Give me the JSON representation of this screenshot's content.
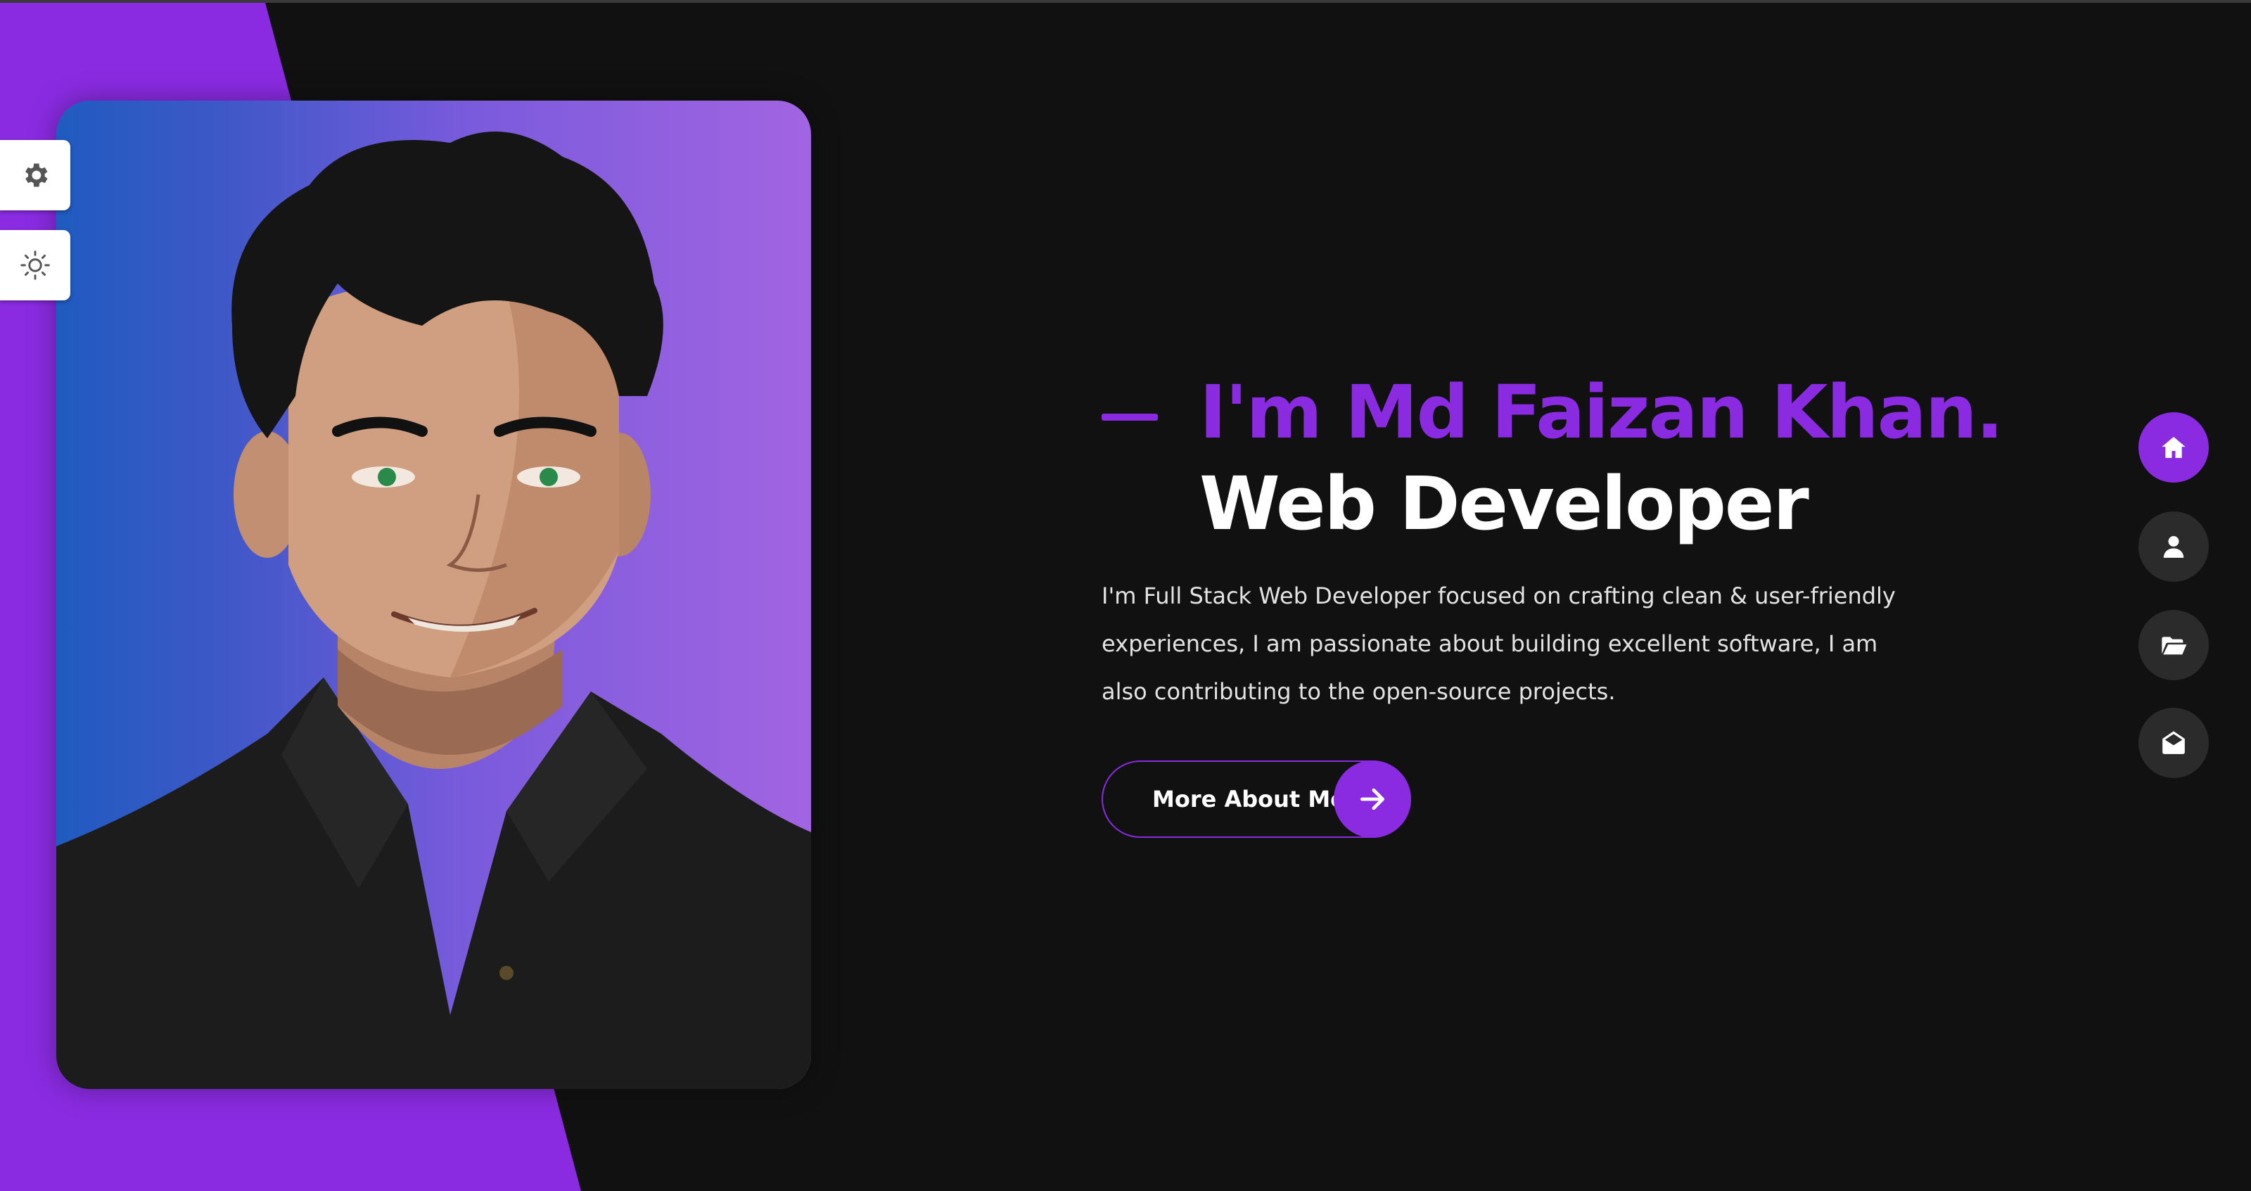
{
  "colors": {
    "accent": "#8a2be2",
    "background": "#111111",
    "nav_idle": "#2b2b2b",
    "text_primary": "#ffffff",
    "text_body": "#e3e3e3"
  },
  "side_controls": [
    {
      "icon": "gear-icon",
      "action": "settings"
    },
    {
      "icon": "sun-icon",
      "action": "theme-toggle"
    }
  ],
  "portrait": {
    "alt": "Md Faizan Khan"
  },
  "hero": {
    "name": "I'm Md Faizan Khan.",
    "role": "Web Developer",
    "description": "I'm Full Stack Web Developer focused on crafting clean & user-friendly experiences, I am passionate about building excellent software, I am also contributing to the open-source projects.",
    "cta_label": "More About Me",
    "cta_icon": "arrow-right-icon"
  },
  "nav": [
    {
      "icon": "home-icon",
      "active": true
    },
    {
      "icon": "user-icon",
      "active": false
    },
    {
      "icon": "folder-open-icon",
      "active": false
    },
    {
      "icon": "envelope-open-icon",
      "active": false
    }
  ]
}
